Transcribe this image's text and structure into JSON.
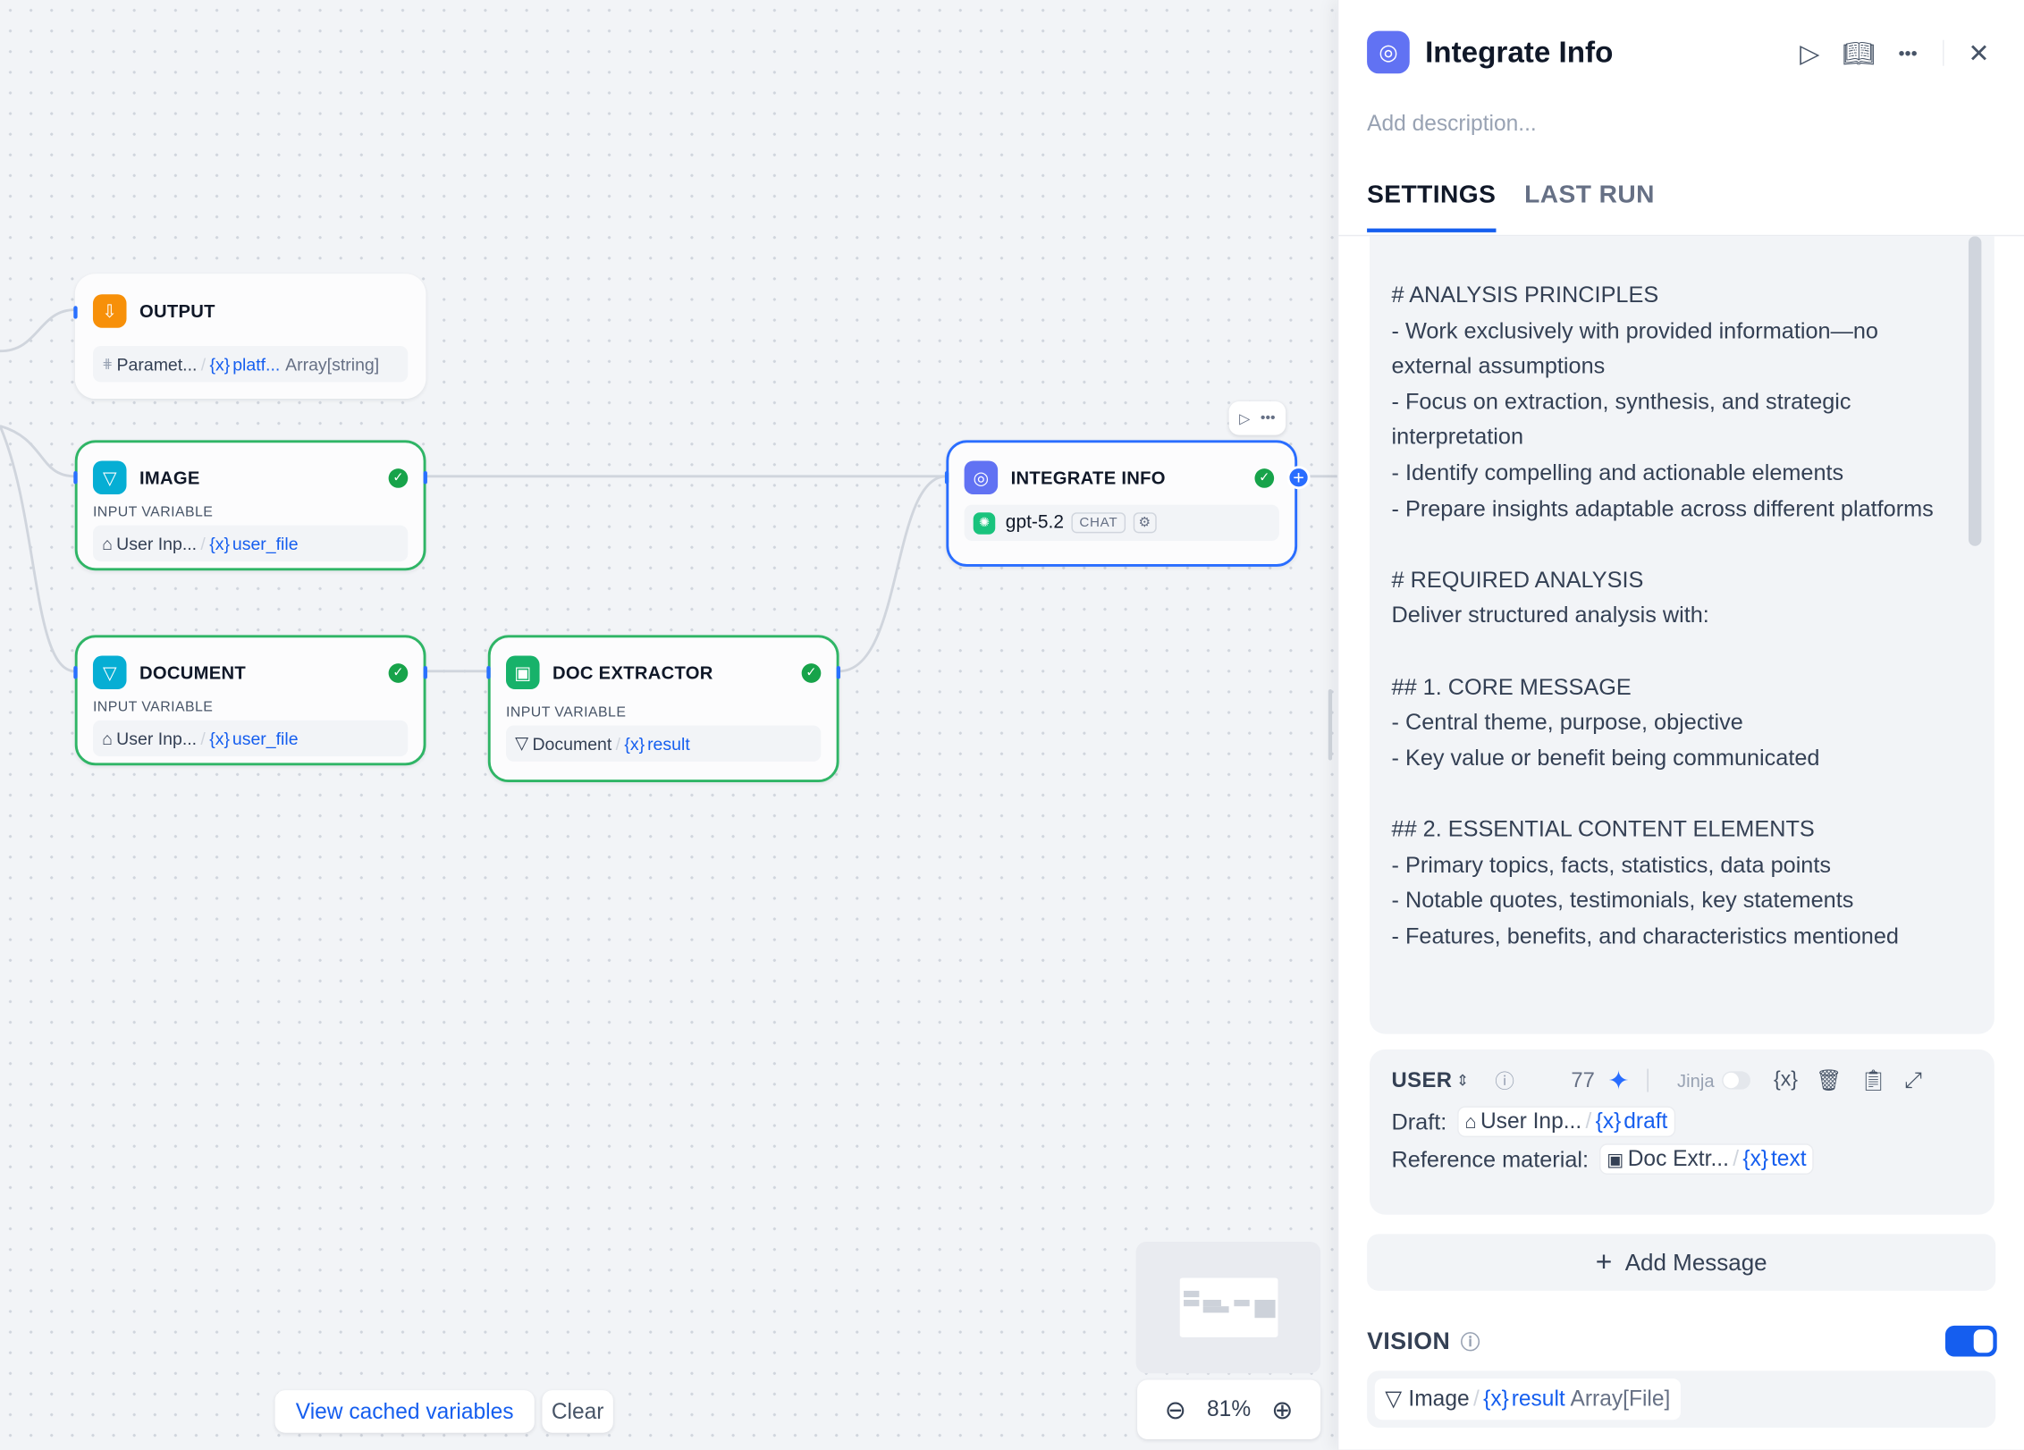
{
  "canvas": {
    "nodes": {
      "output": {
        "title": "OUTPUT",
        "chip_node": "Paramet...",
        "chip_var": "platf...",
        "chip_type": "Array[string]"
      },
      "image": {
        "title": "IMAGE",
        "sub": "INPUT VARIABLE",
        "chip_node": "User Inp...",
        "chip_var": "user_file"
      },
      "document": {
        "title": "DOCUMENT",
        "sub": "INPUT VARIABLE",
        "chip_node": "User Inp...",
        "chip_var": "user_file"
      },
      "doc_extractor": {
        "title": "DOC EXTRACTOR",
        "sub": "INPUT VARIABLE",
        "chip_node": "Document",
        "chip_var": "result"
      },
      "integrate_info": {
        "title": "INTEGRATE INFO",
        "model": "gpt-5.2",
        "model_tag": "CHAT"
      }
    },
    "var_prefix": "{x}",
    "view_cached_label": "View cached variables",
    "clear_label": "Clear",
    "zoom_level": "81%"
  },
  "panel": {
    "title": "Integrate Info",
    "description_placeholder": "Add description...",
    "tabs": [
      "SETTINGS",
      "LAST RUN"
    ],
    "prompt_lines": [
      "# ANALYSIS PRINCIPLES",
      "- Work exclusively with provided information—no external assumptions",
      "- Focus on extraction, synthesis, and strategic interpretation",
      "- Identify compelling and actionable elements",
      "- Prepare insights adaptable across different platforms",
      "",
      "# REQUIRED ANALYSIS",
      "Deliver structured analysis with:",
      "",
      "## 1. CORE MESSAGE",
      "- Central theme, purpose, objective",
      "- Key value or benefit being communicated",
      "",
      "## 2. ESSENTIAL CONTENT ELEMENTS",
      "- Primary topics, facts, statistics, data points",
      "- Notable quotes, testimonials, key statements",
      "- Features, benefits, and characteristics mentioned"
    ],
    "user_message": {
      "role": "USER",
      "token_count": "77",
      "jinja_label": "Jinja",
      "var_icon": "{x}",
      "draft_label": "Draft:",
      "draft_node": "User Inp...",
      "draft_var": "draft",
      "ref_label": "Reference material:",
      "ref_node": "Doc Extr...",
      "ref_var": "text"
    },
    "add_message_label": "Add Message",
    "vision": {
      "label": "VISION",
      "enabled": true,
      "chip_node": "Image",
      "chip_var": "result",
      "chip_type": "Array[File]"
    }
  },
  "colors": {
    "accent": "#155eef",
    "success": "#17a34a",
    "node_selected": "#296dff"
  }
}
